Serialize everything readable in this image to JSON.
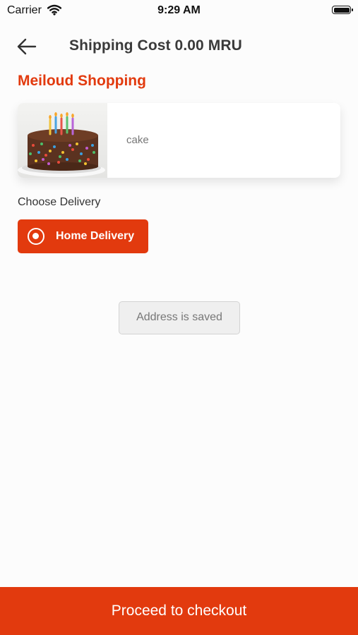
{
  "status_bar": {
    "carrier": "Carrier",
    "time": "9:29 AM"
  },
  "header": {
    "title": "Shipping Cost 0.00 MRU",
    "back_icon": "arrow-left-icon"
  },
  "store": {
    "name": "Meiloud Shopping"
  },
  "product": {
    "name": "cake"
  },
  "delivery": {
    "label": "Choose Delivery",
    "options": [
      "Home Delivery"
    ],
    "selected": "Home Delivery"
  },
  "address": {
    "label": "Address is saved"
  },
  "checkout": {
    "label": "Proceed to checkout"
  },
  "colors": {
    "accent": "#e23a0e",
    "background": "#fcfcfc"
  }
}
